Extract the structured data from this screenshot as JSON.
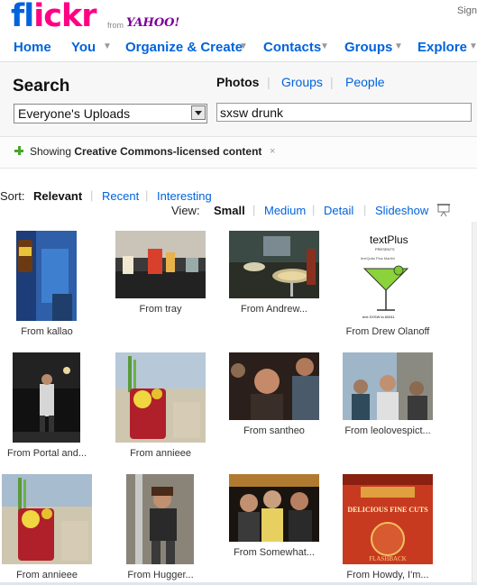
{
  "header": {
    "logo_fl": "fl",
    "logo_ckr": "ickr",
    "logo_from": "from",
    "logo_yahoo": "YAHOO!",
    "signin": "Sign"
  },
  "nav": {
    "home": "Home",
    "you": "You",
    "organize": "Organize & Create",
    "contacts": "Contacts",
    "groups": "Groups",
    "explore": "Explore"
  },
  "search": {
    "title": "Search",
    "type_photos": "Photos",
    "type_groups": "Groups",
    "type_people": "People",
    "scope_selected": "Everyone's Uploads",
    "query": "sxsw drunk"
  },
  "cc_notice": {
    "prefix": "Showing ",
    "bold": "Creative Commons-licensed content",
    "close": "×"
  },
  "sort": {
    "label": "Sort:",
    "relevant": "Relevant",
    "recent": "Recent",
    "interesting": "Interesting"
  },
  "view": {
    "label": "View:",
    "small": "Small",
    "medium": "Medium",
    "detail": "Detail",
    "slideshow": "Slideshow"
  },
  "results": [
    {
      "caption": "From kallao"
    },
    {
      "caption": "From tray"
    },
    {
      "caption": "From Andrew..."
    },
    {
      "caption": "From Drew Olanoff",
      "image_text_1": "textPlus",
      "image_text_2": "PRESENTS",
      "image_text_3": "textQuila Plus Martini",
      "image_text_4": "text SXSW to 60611"
    },
    {
      "caption": "From Portal and..."
    },
    {
      "caption": "From annieee"
    },
    {
      "caption": "From santheo"
    },
    {
      "caption": "From leolovespict..."
    },
    {
      "caption": "From annieee"
    },
    {
      "caption": "From Hugger..."
    },
    {
      "caption": "From Somewhat..."
    },
    {
      "caption": "From Howdy, I'm...",
      "image_text_1": "DELICIOUS FINE CUTS",
      "image_text_2": "FLASHBACK"
    }
  ],
  "colors": {
    "link": "#0063dc",
    "flickr_pink": "#ff0084",
    "cc_green": "#49a52b"
  }
}
